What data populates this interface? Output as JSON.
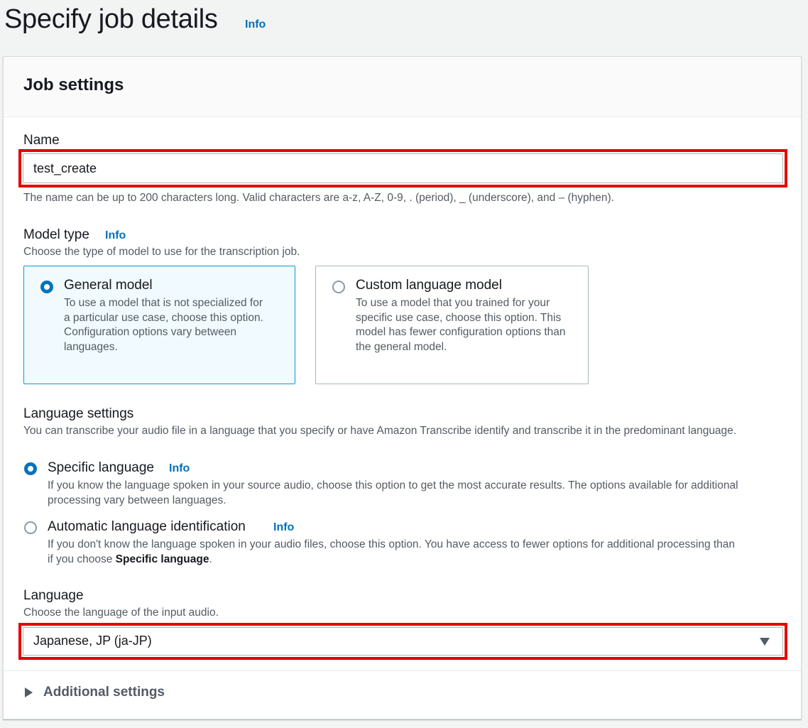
{
  "page": {
    "title": "Specify job details",
    "title_info": "Info"
  },
  "panel": {
    "title": "Job settings"
  },
  "name_field": {
    "label": "Name",
    "value": "test_create",
    "hint": "The name can be up to 200 characters long. Valid characters are a-z, A-Z, 0-9, . (period), _ (underscore), and – (hyphen)."
  },
  "model_type": {
    "label": "Model type",
    "info": "Info",
    "description": "Choose the type of model to use for the transcription job.",
    "options": [
      {
        "title": "General model",
        "description": "To use a model that is not specialized for a particular use case, choose this option. Configuration options vary between languages.",
        "selected": true
      },
      {
        "title": "Custom language model",
        "description": "To use a model that you trained for your specific use case, choose this option. This model has fewer configuration options than the general model.",
        "selected": false
      }
    ]
  },
  "language_settings": {
    "label": "Language settings",
    "description": "You can transcribe your audio file in a language that you specify or have Amazon Transcribe identify and transcribe it in the predominant language.",
    "options": [
      {
        "label": "Specific language",
        "info": "Info",
        "description": "If you know the language spoken in your source audio, choose this option to get the most accurate results. The options available for additional processing vary between languages.",
        "selected": true
      },
      {
        "label": "Automatic language identification",
        "info": "Info",
        "description_prefix": "If you don't know the language spoken in your audio files, choose this option. You have access to fewer options for additional processing than if you choose ",
        "description_bold": "Specific language",
        "description_suffix": ".",
        "selected": false
      }
    ]
  },
  "language": {
    "label": "Language",
    "description": "Choose the language of the input audio.",
    "selected_value": "Japanese, JP (ja-JP)"
  },
  "additional_settings": {
    "label": "Additional settings"
  },
  "colors": {
    "highlight": "#e60000",
    "link": "#0073bb",
    "selected_tile_bg": "#f1faff",
    "selected_tile_border": "#00a1c9"
  }
}
